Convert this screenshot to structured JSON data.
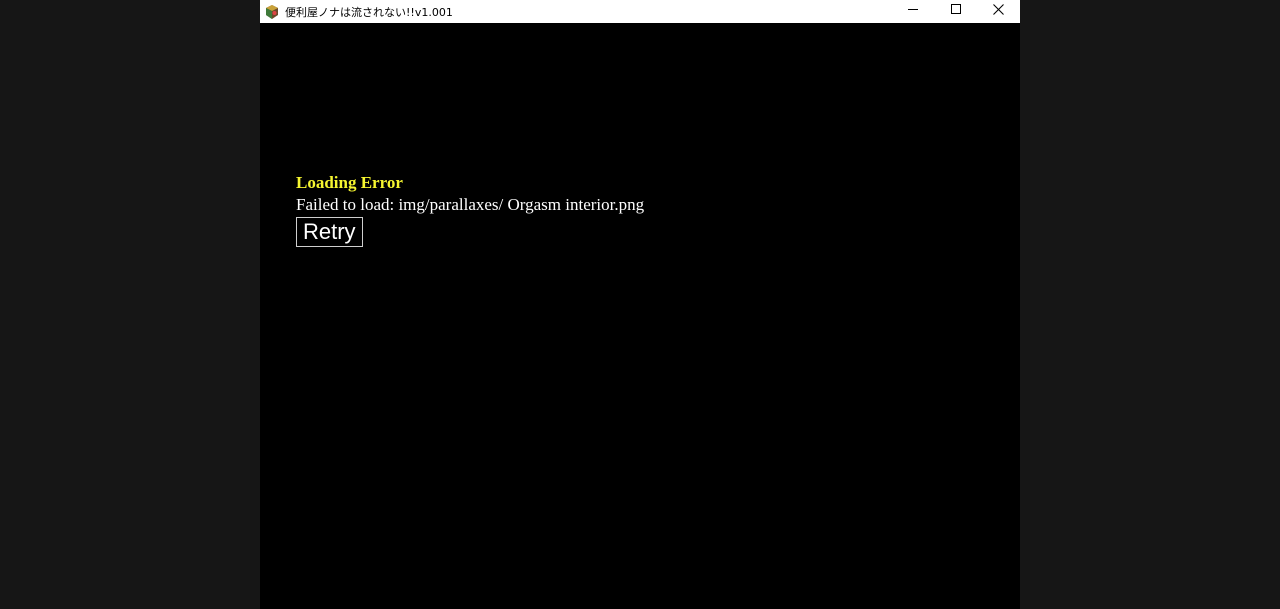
{
  "window": {
    "title": "便利屋ノナは流されない!!v1.001",
    "app_icon": "game-app-icon",
    "controls": {
      "minimize_icon": "minimize-icon",
      "maximize_icon": "maximize-icon",
      "close_icon": "close-icon"
    }
  },
  "error": {
    "title": "Loading Error",
    "message": "Failed to load: img/parallaxes/ Orgasm interior.png",
    "retry_label": "Retry"
  },
  "colors": {
    "background": "#000000",
    "error_title": "#f6f630",
    "text": "#ffffff"
  }
}
